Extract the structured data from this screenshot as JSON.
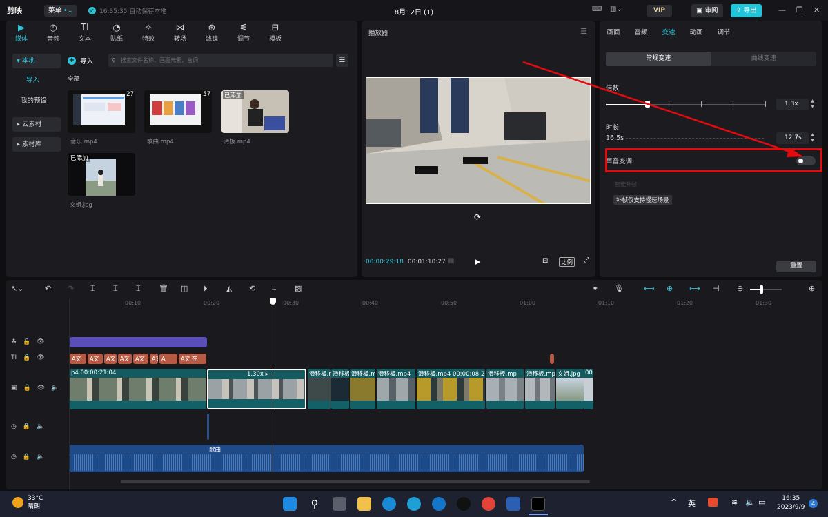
{
  "app": {
    "logo": "剪映",
    "menu_label": "菜单",
    "save_status": "16:35:35 自动保存本地",
    "doc_title": "8月12日 (1)",
    "vip_label": "VIP",
    "review_label": "审阅",
    "export_label": "导出"
  },
  "media_panel": {
    "tabs": [
      {
        "label": "媒体",
        "icon": "media-icon"
      },
      {
        "label": "音频",
        "icon": "audio-icon"
      },
      {
        "label": "文本",
        "icon": "text-icon"
      },
      {
        "label": "贴纸",
        "icon": "sticker-icon"
      },
      {
        "label": "特效",
        "icon": "effects-icon"
      },
      {
        "label": "转场",
        "icon": "transition-icon"
      },
      {
        "label": "滤镜",
        "icon": "filter-icon"
      },
      {
        "label": "调节",
        "icon": "adjust-icon"
      },
      {
        "label": "模板",
        "icon": "template-icon"
      }
    ],
    "sidebar": {
      "local": "本地",
      "import": "导入",
      "presets": "我的预设",
      "cloud": "云素材",
      "library": "素材库"
    },
    "import_label": "导入",
    "search_placeholder": "搜索文件名称、画面元素、台词",
    "all_label": "全部",
    "items": [
      {
        "name": "音乐.mp4",
        "duration": "27"
      },
      {
        "name": "歌曲.mp4",
        "duration": "57"
      },
      {
        "name": "滑板.mp4",
        "badge": "已添加"
      },
      {
        "name": "文姐.jpg",
        "badge": "已添加"
      }
    ]
  },
  "player": {
    "title": "播放器",
    "current_time": "00:00:29:18",
    "total_time": "00:01:10:27",
    "ratio_label": "比例"
  },
  "inspector": {
    "tabs": [
      "画面",
      "音频",
      "变速",
      "动画",
      "调节"
    ],
    "active_tab": "变速",
    "segments": [
      "常规变速",
      "曲线变速"
    ],
    "multiplier_label": "倍数",
    "multiplier_value": "1.3x",
    "duration_label": "时长",
    "duration_original": "16.5s",
    "duration_value": "12.7s",
    "pitch_label": "声音变调",
    "smart_fill_label": "智能补帧",
    "hint": "补帧仅支持慢速场景",
    "reset_label": "重置"
  },
  "timeline": {
    "ruler": [
      "00:10",
      "00:20",
      "00:30",
      "00:40",
      "00:50",
      "01:00",
      "01:10",
      "01:20",
      "01:30"
    ],
    "video_clips": [
      {
        "label": "p4  00:00:21:04"
      },
      {
        "label": "1.30x ▸"
      },
      {
        "label": "滑移板.r"
      },
      {
        "label": "滑移板"
      },
      {
        "label": "滑移板.m"
      },
      {
        "label": "滑移板.mp4"
      },
      {
        "label": "滑移板.mp4  00:00:08:2"
      },
      {
        "label": "滑移板.mp"
      },
      {
        "label": "滑移板.mp"
      },
      {
        "label": "文姐.jpg"
      },
      {
        "label": "00:"
      }
    ],
    "text_clips": [
      "A文",
      "A文",
      "A文",
      "A文",
      "A文",
      "A文",
      "A",
      "A文 在",
      "A"
    ],
    "audio_label": "歌曲"
  },
  "taskbar": {
    "temp": "33°C",
    "weather": "晴朗",
    "ime": "英",
    "time": "16:35",
    "date": "2023/9/9",
    "notif_count": "4"
  },
  "colors": {
    "accent": "#2fc5da",
    "highlight": "#e40a0e",
    "video_clip": "#145a5f",
    "audio_clip": "#1f4a85"
  }
}
